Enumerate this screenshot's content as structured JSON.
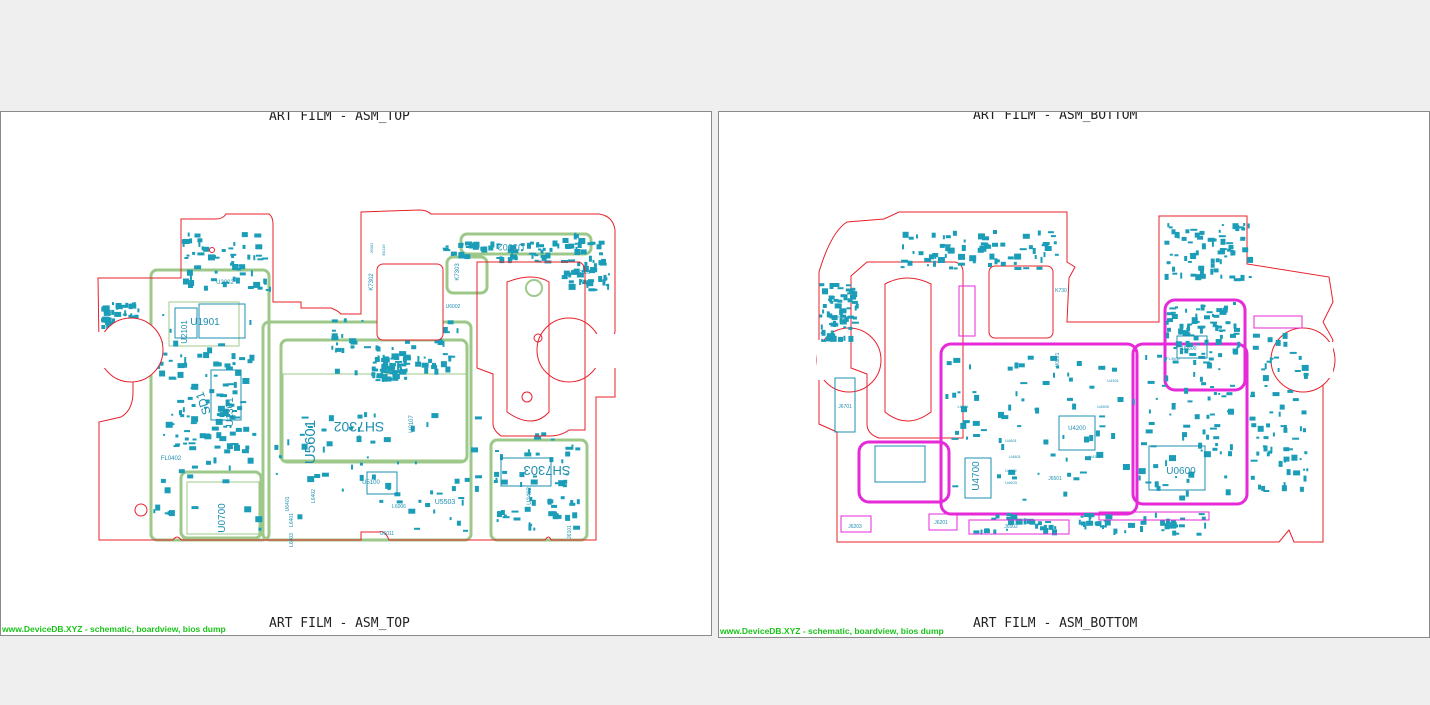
{
  "colors": {
    "outline": "#e8202a",
    "component": "#1e8fb0",
    "component_fill": "#1b9db8",
    "top_trace": "#9cc98a",
    "bottom_trace": "#e62ad8",
    "watermark": "#19c419",
    "background": "#efefef"
  },
  "panels": {
    "top": {
      "header": "ART FILM - ASM_TOP",
      "footer": "ART FILM - ASM_TOP",
      "watermark": "www.DeviceDB.XYZ - schematic, boardview, bios dump",
      "labels": [
        "U1901",
        "U2101",
        "U2002",
        "U1301",
        "SD1",
        "FL0402",
        "U0700",
        "U5601",
        "SH7302",
        "U5100",
        "U5503",
        "K7302",
        "K7303",
        "U0107",
        "SH7303",
        "U2402",
        "J6101",
        "L6401",
        "L6403",
        "L6402",
        "L6006",
        "U6002",
        "U6011",
        "U6401",
        "U2001",
        "U3002",
        "B0116",
        "J6002"
      ]
    },
    "bottom": {
      "header": "ART FILM - ASM_BOTTOM",
      "footer": "ART FILM - ASM_BOTTOM",
      "watermark": "www.DeviceDB.XYZ - schematic, boardview, bios dump",
      "labels": [
        "J6701",
        "J6203",
        "J6201",
        "J6502",
        "U0600",
        "U0800",
        "U4200",
        "U4700",
        "K730",
        "U0221",
        "J6501",
        "U4801",
        "U4301",
        "L6001",
        "J6003",
        "FL3600",
        "U4505",
        "U4303",
        "U4601",
        "U4602",
        "U4603"
      ]
    }
  }
}
